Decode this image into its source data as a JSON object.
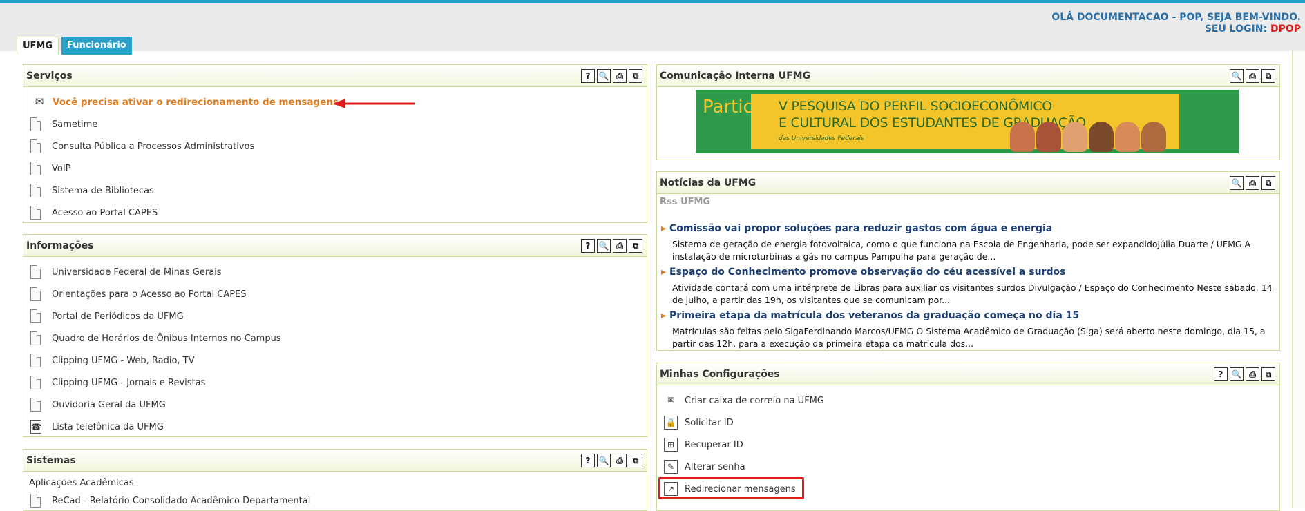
{
  "header": {
    "greeting": "OLÁ DOCUMENTACAO - POP, SEJA BEM-VINDO.",
    "login_label": "SEU LOGIN: ",
    "login_value": "DPOP",
    "tabs": [
      {
        "label": "UFMG"
      },
      {
        "label": "Funcionário"
      }
    ]
  },
  "controls": {
    "help": "?",
    "search": "🔍",
    "print": "⎙",
    "window": "⧉"
  },
  "servicos": {
    "title": "Serviços",
    "items": [
      {
        "label": "Você precisa ativar o redirecionamento de mensagens"
      },
      {
        "label": "Sametime"
      },
      {
        "label": "Consulta Pública a Processos Administrativos"
      },
      {
        "label": "VoIP"
      },
      {
        "label": "Sistema de Bibliotecas"
      },
      {
        "label": "Acesso ao Portal CAPES"
      }
    ]
  },
  "informacoes": {
    "title": "Informações",
    "items": [
      {
        "label": "Universidade Federal de Minas Gerais"
      },
      {
        "label": "Orientações para o Acesso ao Portal CAPES"
      },
      {
        "label": "Portal de Periódicos da UFMG"
      },
      {
        "label": "Quadro de Horários de Ônibus Internos no Campus"
      },
      {
        "label": "Clipping UFMG - Web, Radio, TV"
      },
      {
        "label": "Clipping UFMG - Jornais e Revistas"
      },
      {
        "label": "Ouvidoria Geral da UFMG"
      },
      {
        "label": "Lista telefônica da UFMG"
      }
    ]
  },
  "sistemas": {
    "title": "Sistemas",
    "subheading": "Aplicações Acadêmicas",
    "items": [
      {
        "label": "ReCad - Relatório Consolidado Acadêmico Departamental"
      }
    ]
  },
  "comunicacao": {
    "title": "Comunicação Interna UFMG",
    "banner": {
      "lead": "Participe da",
      "line1": "V PESQUISA DO PERFIL SOCIOECONÔMICO",
      "line2": "E CULTURAL DOS ESTUDANTES DE GRADUAÇÃO",
      "sub": "das Universidades Federais"
    }
  },
  "noticias": {
    "title": "Notícias da UFMG",
    "feed_label": "Rss UFMG",
    "items": [
      {
        "headline": "Comissão vai propor soluções para reduzir gastos com água e energia",
        "body": "Sistema de geração de energia fotovoltaica, como o que funciona na Escola de Engenharia, pode ser expandidoJúlia Duarte / UFMG A instalação de microturbinas a gás no campus Pampulha para geração de..."
      },
      {
        "headline": "Espaço do Conhecimento promove observação do céu acessível a surdos",
        "body": "Atividade contará com uma intérprete de Libras para auxiliar os visitantes surdos Divulgação / Espaço do Conhecimento Neste sábado, 14 de julho, a partir das 19h, os visitantes que se comunicam por..."
      },
      {
        "headline": "Primeira etapa da matrícula dos veteranos da graduação começa no dia 15",
        "body": "Matrículas são feitas pelo SigaFerdinando Marcos/UFMG O Sistema Acadêmico de Graduação (Siga) será aberto neste domingo, dia 15, a partir das 12h, para a execução da primeira etapa da matrícula dos..."
      }
    ]
  },
  "configuracoes": {
    "title": "Minhas Configurações",
    "items": [
      {
        "label": "Criar caixa de correio na UFMG",
        "icon": "✉"
      },
      {
        "label": "Solicitar ID",
        "icon": "🔒"
      },
      {
        "label": "Recuperar ID",
        "icon": "⊞"
      },
      {
        "label": "Alterar senha",
        "icon": "✎"
      },
      {
        "label": "Redirecionar mensagens",
        "icon": "↗"
      }
    ]
  }
}
